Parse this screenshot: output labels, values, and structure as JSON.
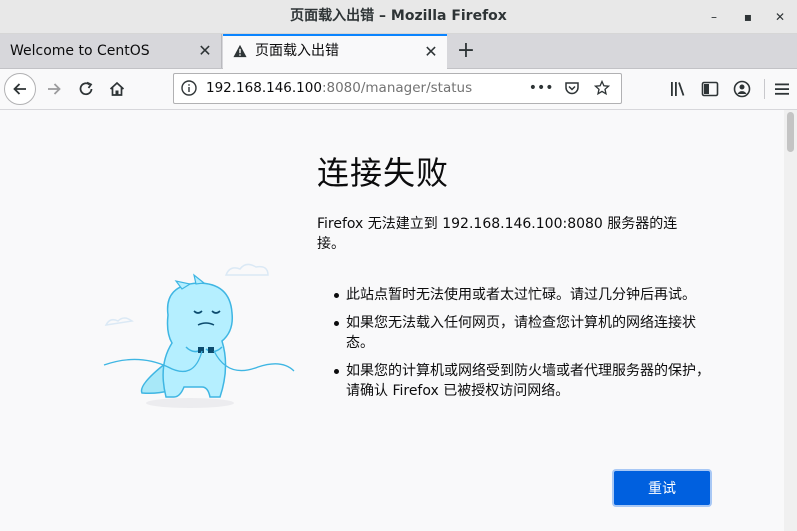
{
  "window": {
    "title": "页面载入出错 – Mozilla Firefox",
    "minimize_glyph": "–",
    "maximize_glyph": "▪",
    "close_glyph": "✕"
  },
  "tabs": [
    {
      "label": "Welcome to CentOS",
      "active": false
    },
    {
      "label": "页面载入出错",
      "active": true,
      "icon": "warning-icon"
    }
  ],
  "new_tab_glyph": "+",
  "nav": {
    "url_host": "192.168.146.100",
    "url_rest": ":8080/manager/status",
    "icons": [
      "back-icon",
      "forward-icon",
      "reload-icon",
      "home-icon",
      "library-icon",
      "sidebar-icon",
      "account-icon",
      "menu-icon"
    ]
  },
  "error": {
    "title": "连接失败",
    "description": "Firefox 无法建立到 192.168.146.100:8080 服务器的连接。",
    "bullets": [
      "此站点暂时无法使用或者太过忙碌。请过几分钟后再试。",
      "如果您无法载入任何网页，请检查您计算机的网络连接状态。",
      "如果您的计算机或网络受到防火墙或者代理服务器的保护，请确认 Firefox 已被授权访问网络。"
    ],
    "retry_label": "重试"
  },
  "colors": {
    "accent": "#0060df",
    "tab_highlight": "#0a84ff",
    "illustration": "#80ebff"
  }
}
